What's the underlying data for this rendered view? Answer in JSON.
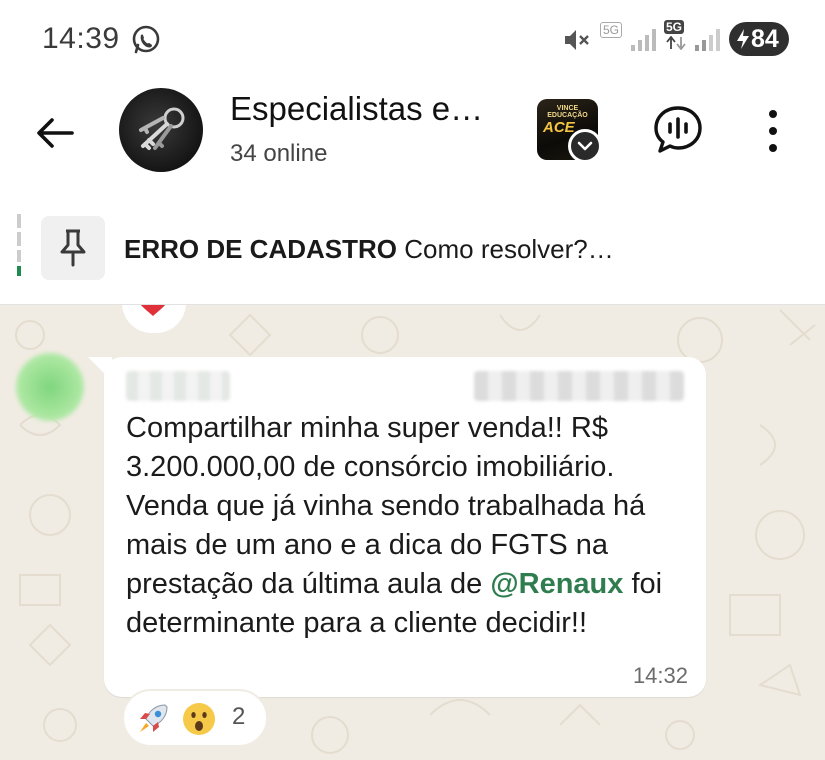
{
  "status_bar": {
    "time": "14:39",
    "network_1": "5G",
    "network_2": "5G",
    "battery_level": "84",
    "icons": [
      "whatsapp-icon",
      "mute-icon",
      "signal-icon",
      "battery-charging-icon"
    ]
  },
  "header": {
    "title": "Especialistas e…",
    "subtitle": "34 online",
    "thumbnail_top_text": "VINCE EDUCAÇÃO",
    "thumbnail_text": "ACE",
    "icons": [
      "back-arrow-icon",
      "group-avatar",
      "chevron-down-icon",
      "voice-chat-icon",
      "more-vertical-icon"
    ]
  },
  "pinned": {
    "title": "ERRO DE CADASTRO",
    "text": "Como resolver?…",
    "icon": "pin-icon"
  },
  "message": {
    "text_before": "Compartilhar minha super venda!! R$ 3.200.000,00 de consórcio imobiliário. Venda que já vinha sendo trabalhada há mais de um ano e a dica do FGTS na prestação da última aula de ",
    "mention": "@Renaux",
    "text_after": " foi determinante para a cliente decidir!!",
    "time": "14:32"
  },
  "reactions": {
    "emojis": [
      "rocket-icon",
      "surprised-face-icon"
    ],
    "count": "2"
  },
  "previous_reaction": "heart-icon",
  "colors": {
    "chat_background": "#f1ece3",
    "mention": "#2f7d4f",
    "bubble": "#ffffff",
    "reaction_heart": "#e0303a"
  }
}
